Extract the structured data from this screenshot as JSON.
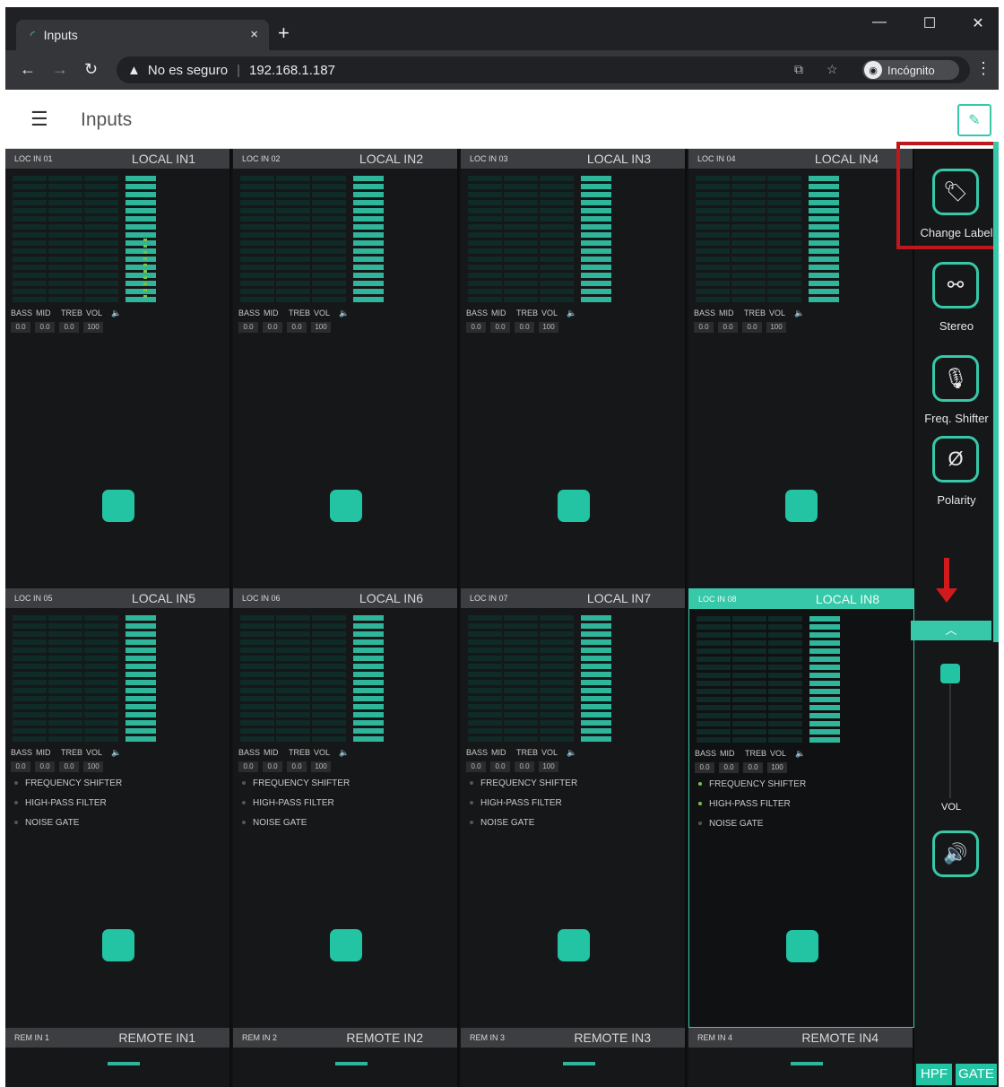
{
  "browser": {
    "tab_title": "Inputs",
    "tab_close": "×",
    "new_tab": "+",
    "security": "No es seguro",
    "url": "192.168.1.187",
    "profile": "Incógnito",
    "minimize": "—",
    "maximize": "☐",
    "close": "✕"
  },
  "app": {
    "menu_icon": "☰",
    "title": "Inputs"
  },
  "eq_labels": [
    "BASS",
    "MID",
    "TREB",
    "VOL"
  ],
  "eq_values": [
    "0.0",
    "0.0",
    "0.0",
    "100"
  ],
  "filters": [
    "FREQUENCY SHIFTER",
    "HIGH-PASS FILTER",
    "NOISE GATE"
  ],
  "channels": [
    {
      "short": "LOC IN 01",
      "name": "LOCAL IN1"
    },
    {
      "short": "LOC IN 02",
      "name": "LOCAL IN2"
    },
    {
      "short": "LOC IN 03",
      "name": "LOCAL IN3"
    },
    {
      "short": "LOC IN 04",
      "name": "LOCAL IN4"
    },
    {
      "short": "LOC IN 05",
      "name": "LOCAL IN5"
    },
    {
      "short": "LOC IN 06",
      "name": "LOCAL IN6"
    },
    {
      "short": "LOC IN 07",
      "name": "LOCAL IN7"
    },
    {
      "short": "LOC IN 08",
      "name": "LOCAL IN8"
    },
    {
      "short": "REM IN 1",
      "name": "REMOTE IN1"
    },
    {
      "short": "REM IN 2",
      "name": "REMOTE IN2"
    },
    {
      "short": "REM IN 3",
      "name": "REMOTE IN3"
    },
    {
      "short": "REM IN 4",
      "name": "REMOTE IN4"
    }
  ],
  "selected_channel": 7,
  "active_filters_selected": [
    "FREQUENCY SHIFTER",
    "HIGH-PASS FILTER"
  ],
  "right_panel": {
    "change_label": "Change Label",
    "stereo": "Stereo",
    "freq_shifter": "Freq. Shifter",
    "polarity": "Polarity",
    "vol": "VOL",
    "hpf": "HPF",
    "gate": "GATE"
  },
  "colors": {
    "accent": "#36c8a8",
    "highlight": "#c0171c"
  }
}
